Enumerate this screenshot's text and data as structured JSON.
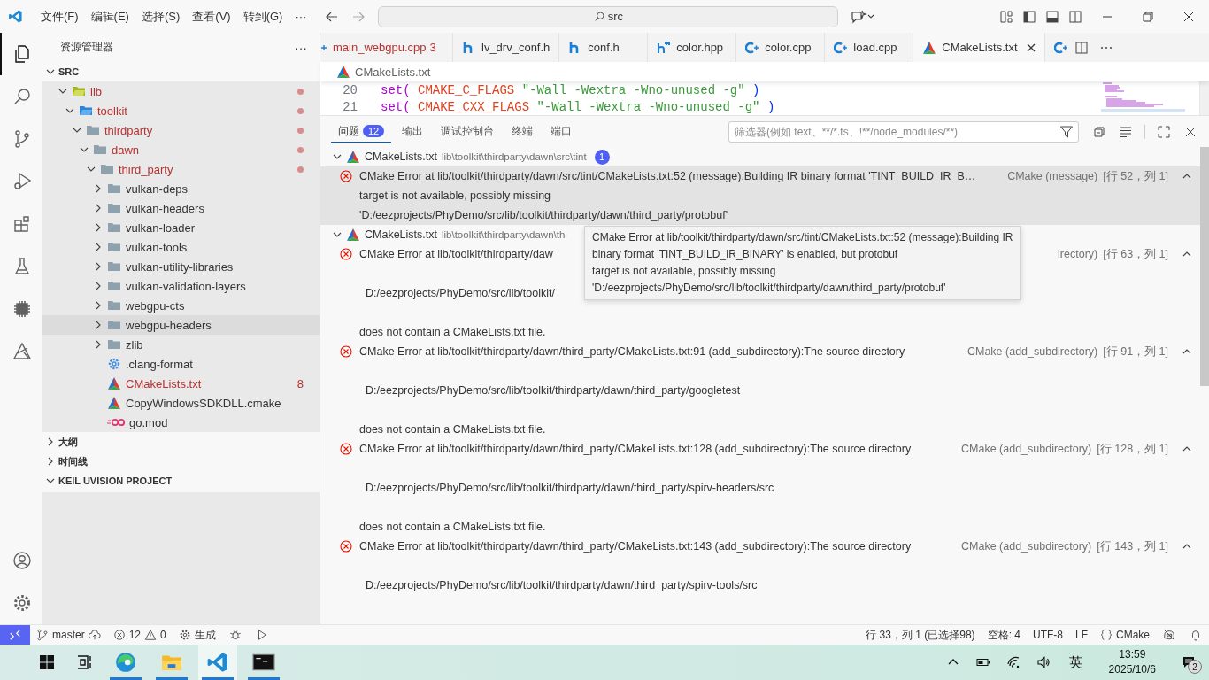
{
  "title_bar": {
    "menus": [
      "文件(F)",
      "编辑(E)",
      "选择(S)",
      "查看(V)",
      "转到(G)"
    ],
    "more": "···",
    "search": {
      "value": "src"
    }
  },
  "activity_bar": {
    "items": [
      {
        "kind": "files",
        "selected": true
      },
      {
        "kind": "search",
        "selected": false
      },
      {
        "kind": "source-control",
        "selected": false
      },
      {
        "kind": "run-debug",
        "selected": false
      },
      {
        "kind": "extensions",
        "selected": false
      },
      {
        "kind": "flask",
        "selected": false
      },
      {
        "kind": "chip",
        "selected": false
      },
      {
        "kind": "triangle-tool",
        "selected": false
      }
    ],
    "bottom": [
      {
        "kind": "account"
      },
      {
        "kind": "settings"
      }
    ]
  },
  "sidebar": {
    "title": "资源管理器",
    "more": "···",
    "section": {
      "label": "SRC",
      "expanded": true
    },
    "tree": [
      {
        "label": "lib",
        "kind": "folder-lib",
        "expanded": true,
        "modified": true,
        "selected": false,
        "children": [
          {
            "label": "toolkit",
            "kind": "folder-blue",
            "expanded": true,
            "modified": true,
            "selected": false,
            "children": [
              {
                "label": "thirdparty",
                "kind": "folder",
                "expanded": true,
                "modified": true,
                "selected": false,
                "children": [
                  {
                    "label": "dawn",
                    "kind": "folder",
                    "expanded": true,
                    "modified": true,
                    "selected": false,
                    "children": [
                      {
                        "label": "third_party",
                        "kind": "folder",
                        "expanded": true,
                        "modified": true,
                        "selected": false,
                        "children": [
                          {
                            "label": "vulkan-deps",
                            "kind": "folder",
                            "expanded": false,
                            "modified": false,
                            "selected": false
                          },
                          {
                            "label": "vulkan-headers",
                            "kind": "folder",
                            "expanded": false,
                            "modified": false,
                            "selected": false
                          },
                          {
                            "label": "vulkan-loader",
                            "kind": "folder",
                            "expanded": false,
                            "modified": false,
                            "selected": false
                          },
                          {
                            "label": "vulkan-tools",
                            "kind": "folder",
                            "expanded": false,
                            "modified": false,
                            "selected": false
                          },
                          {
                            "label": "vulkan-utility-libraries",
                            "kind": "folder",
                            "expanded": false,
                            "modified": false,
                            "selected": false
                          },
                          {
                            "label": "vulkan-validation-layers",
                            "kind": "folder",
                            "expanded": false,
                            "modified": false,
                            "selected": false
                          },
                          {
                            "label": "webgpu-cts",
                            "kind": "folder",
                            "expanded": false,
                            "modified": false,
                            "selected": false
                          },
                          {
                            "label": "webgpu-headers",
                            "kind": "folder",
                            "expanded": false,
                            "modified": false,
                            "selected": true
                          },
                          {
                            "label": "zlib",
                            "kind": "folder",
                            "expanded": false,
                            "modified": false,
                            "selected": false
                          },
                          {
                            "label": ".clang-format",
                            "kind": "gear-file",
                            "modified": false,
                            "selected": false
                          },
                          {
                            "label": "CMakeLists.txt",
                            "kind": "cmake-file",
                            "modified": true,
                            "badge": "8",
                            "selected": false
                          },
                          {
                            "label": "CopyWindowsSDKDLL.cmake",
                            "kind": "cmake-file",
                            "modified": false,
                            "selected": false
                          },
                          {
                            "label": "go.mod",
                            "kind": "go-file",
                            "modified": false,
                            "selected": false
                          }
                        ]
                      }
                    ]
                  }
                ]
              }
            ]
          }
        ]
      }
    ],
    "sections": [
      {
        "label": "大纲",
        "expanded": false
      },
      {
        "label": "时间线",
        "expanded": false
      },
      {
        "label": "KEIL UVISION PROJECT",
        "expanded": true
      }
    ]
  },
  "tabs": [
    {
      "label": "main_webgpu.cpp",
      "kind": "cpp-cut",
      "badge": "3",
      "has_errors": true,
      "selected": false
    },
    {
      "label": "lv_drv_conf.h",
      "kind": "h",
      "has_errors": false,
      "selected": false
    },
    {
      "label": "conf.h",
      "kind": "h",
      "has_errors": false,
      "selected": false
    },
    {
      "label": "color.hpp",
      "kind": "hpp",
      "has_errors": false,
      "selected": false
    },
    {
      "label": "color.cpp",
      "kind": "cpp",
      "has_errors": false,
      "selected": false
    },
    {
      "label": "load.cpp",
      "kind": "cpp",
      "has_errors": false,
      "selected": false
    },
    {
      "label": "CMakeLists.txt",
      "kind": "cmake",
      "has_errors": false,
      "selected": true
    }
  ],
  "breadcrumb": {
    "label": "CMakeLists.txt"
  },
  "code": [
    {
      "number": "20",
      "tokens": [
        {
          "kind": "keyword",
          "text": "set("
        },
        {
          "kind": "variable",
          "text": " CMAKE_C_FLAGS"
        },
        {
          "kind": "string",
          "text": " \"-Wall -Wextra -Wno-unused -g\""
        },
        {
          "kind": "punct",
          "text": " )"
        }
      ]
    },
    {
      "number": "21",
      "tokens": [
        {
          "kind": "keyword",
          "text": "set("
        },
        {
          "kind": "variable",
          "text": " CMAKE_CXX_FLAGS"
        },
        {
          "kind": "string",
          "text": " \"-Wall -Wextra -Wno-unused -g\""
        },
        {
          "kind": "punct",
          "text": " )"
        }
      ]
    }
  ],
  "panel": {
    "tabs": [
      {
        "label": "问题",
        "badge": "12",
        "selected": true
      },
      {
        "label": "输出",
        "selected": false
      },
      {
        "label": "调试控制台",
        "selected": false
      },
      {
        "label": "终端",
        "selected": false
      },
      {
        "label": "端口",
        "selected": false
      }
    ],
    "filter": {
      "placeholder": "筛选器(例如 text、**/*.ts、!**/node_modules/**)"
    },
    "groups": [
      {
        "file": "CMakeLists.txt",
        "path": "lib\\toolkit\\thirdparty\\dawn\\src\\tint",
        "count": "1",
        "expanded": true,
        "items": [
          {
            "kind": "error",
            "selected": true,
            "message": "CMake Error at lib/toolkit/thirdparty/dawn/src/tint/CMakeLists.txt:52 (message):Building IR binary format 'TINT_BUILD_IR_B…",
            "source": "CMake (message)",
            "location": "[行 52，列 1]",
            "details": [
              {
                "kind": "plain",
                "text": "target is not available, possibly missing"
              },
              {
                "kind": "plain",
                "text": "'D:/eezprojects/PhyDemo/src/lib/toolkit/thirdparty/dawn/third_party/protobuf'"
              }
            ]
          }
        ]
      },
      {
        "file": "CMakeLists.txt",
        "path": "lib\\toolkit\\thirdparty\\dawn\\thi",
        "expanded": true,
        "items": [
          {
            "kind": "error",
            "selected": false,
            "message": "CMake Error at lib/toolkit/thirdparty/daw",
            "source": "irectory)",
            "location": "[行 63，列 1]",
            "details": [
              {
                "kind": "path",
                "text": "D:/eezprojects/PhyDemo/src/lib/toolkit/"
              },
              {
                "kind": "note",
                "text": "does not contain a CMakeLists.txt file."
              }
            ]
          },
          {
            "kind": "error",
            "selected": false,
            "message": "CMake Error at lib/toolkit/thirdparty/dawn/third_party/CMakeLists.txt:91 (add_subdirectory):The source directory",
            "source": "CMake (add_subdirectory)",
            "location": "[行 91，列 1]",
            "details": [
              {
                "kind": "path",
                "text": "D:/eezprojects/PhyDemo/src/lib/toolkit/thirdparty/dawn/third_party/googletest"
              },
              {
                "kind": "note",
                "text": "does not contain a CMakeLists.txt file."
              }
            ]
          },
          {
            "kind": "error",
            "selected": false,
            "message": "CMake Error at lib/toolkit/thirdparty/dawn/third_party/CMakeLists.txt:128 (add_subdirectory):The source directory",
            "source": "CMake (add_subdirectory)",
            "location": "[行 128，列 1]",
            "details": [
              {
                "kind": "path",
                "text": "D:/eezprojects/PhyDemo/src/lib/toolkit/thirdparty/dawn/third_party/spirv-headers/src"
              },
              {
                "kind": "note",
                "text": "does not contain a CMakeLists.txt file."
              }
            ]
          },
          {
            "kind": "error",
            "selected": false,
            "message": "CMake Error at lib/toolkit/thirdparty/dawn/third_party/CMakeLists.txt:143 (add_subdirectory):The source directory",
            "source": "CMake (add_subdirectory)",
            "location": "[行 143，列 1]",
            "details": [
              {
                "kind": "path",
                "text": "D:/eezprojects/PhyDemo/src/lib/toolkit/thirdparty/dawn/third_party/spirv-tools/src"
              }
            ]
          }
        ]
      }
    ],
    "tooltip": {
      "lines": [
        "CMake Error at lib/toolkit/thirdparty/dawn/src/tint/CMakeLists.txt:52 (message):Building IR",
        "binary format 'TINT_BUILD_IR_BINARY' is enabled, but protobuf",
        "target is not available, possibly missing",
        "'D:/eezprojects/PhyDemo/src/lib/toolkit/thirdparty/dawn/third_party/protobuf'"
      ]
    }
  },
  "status_bar": {
    "branch": "master",
    "errors": "12",
    "warnings": "0",
    "build": "生成",
    "right": [
      "行 33，列 1 (已选择98)",
      "空格: 4",
      "UTF-8",
      "LF"
    ],
    "language": "CMake"
  },
  "taskbar": {
    "apps": [
      {
        "kind": "edge",
        "running": true,
        "selected": false
      },
      {
        "kind": "explorer",
        "running": true,
        "selected": false
      },
      {
        "kind": "vscode",
        "running": true,
        "selected": true
      },
      {
        "kind": "terminal",
        "running": true,
        "selected": false
      }
    ],
    "ime": "英",
    "time": "13:59",
    "date": "2025/10/6",
    "notifications": "2"
  }
}
